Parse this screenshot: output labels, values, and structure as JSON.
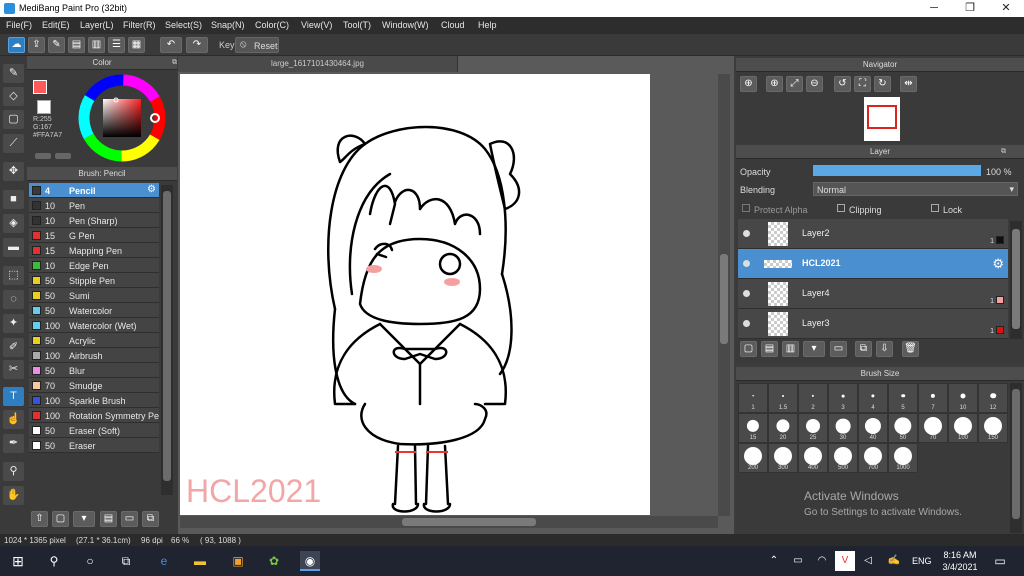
{
  "window": {
    "title": "MediBang Paint Pro (32bit)",
    "minimize": "─",
    "maximize": "❐",
    "close": "✕"
  },
  "menu": [
    "File(F)",
    "Edit(E)",
    "Layer(L)",
    "Filter(R)",
    "Select(S)",
    "Snap(N)",
    "Color(C)",
    "View(V)",
    "Tool(T)",
    "Window(W)",
    "Cloud",
    "Help"
  ],
  "toolbar": {
    "key_label": "Key",
    "reset_label": "Reset"
  },
  "color_panel": {
    "title": "Color",
    "r": "R:255",
    "g": "G:167",
    "hex": "#FFA7A7",
    "primary": "#ff5a5a",
    "secondary": "#ffffff"
  },
  "brush_panel": {
    "title": "Brush: Pencil",
    "brushes": [
      {
        "size": "4",
        "name": "Pencil",
        "color": "#3a3a3a"
      },
      {
        "size": "10",
        "name": "Pen",
        "color": "#333333"
      },
      {
        "size": "10",
        "name": "Pen (Sharp)",
        "color": "#333333"
      },
      {
        "size": "15",
        "name": "G Pen",
        "color": "#e53030"
      },
      {
        "size": "15",
        "name": "Mapping Pen",
        "color": "#e53030"
      },
      {
        "size": "10",
        "name": "Edge Pen",
        "color": "#3dbb3d"
      },
      {
        "size": "50",
        "name": "Stipple Pen",
        "color": "#e8d020"
      },
      {
        "size": "50",
        "name": "Sumi",
        "color": "#e8d020"
      },
      {
        "size": "50",
        "name": "Watercolor",
        "color": "#66ccee"
      },
      {
        "size": "100",
        "name": "Watercolor (Wet)",
        "color": "#66ccee"
      },
      {
        "size": "50",
        "name": "Acrylic",
        "color": "#e8d020"
      },
      {
        "size": "100",
        "name": "Airbrush",
        "color": "#aaaaaa"
      },
      {
        "size": "50",
        "name": "Blur",
        "color": "#f08ae8"
      },
      {
        "size": "70",
        "name": "Smudge",
        "color": "#f5c9a0"
      },
      {
        "size": "100",
        "name": "Sparkle Brush",
        "color": "#3355dd"
      },
      {
        "size": "100",
        "name": "Rotation Symmetry Pe",
        "color": "#e53030"
      },
      {
        "size": "50",
        "name": "Eraser (Soft)",
        "color": "#ffffff"
      },
      {
        "size": "50",
        "name": "Eraser",
        "color": "#ffffff"
      }
    ]
  },
  "document": {
    "tab": "large_1617101430464.jpg",
    "watermark": "HCL2021"
  },
  "navigator": {
    "title": "Navigator"
  },
  "layer_panel": {
    "title": "Layer",
    "opacity_label": "Opacity",
    "opacity_value": "100 %",
    "opacity_fraction": 1.0,
    "blending_label": "Blending",
    "blending_value": "Normal",
    "protect_alpha": "Protect Alpha",
    "clipping": "Clipping",
    "lock": "Lock",
    "layers": [
      {
        "name": "Layer2",
        "color": "#111111",
        "num": "1"
      },
      {
        "name": "HCL2021",
        "color": "",
        "num": ""
      },
      {
        "name": "Layer4",
        "color": "#f4a0a0",
        "num": "1"
      },
      {
        "name": "Layer3",
        "color": "#dd1111",
        "num": "1"
      }
    ]
  },
  "brush_size": {
    "title": "Brush Size",
    "sizes": [
      "1",
      "1.5",
      "2",
      "3",
      "4",
      "5",
      "7",
      "10",
      "12",
      "15",
      "20",
      "25",
      "30",
      "40",
      "50",
      "70",
      "100",
      "150",
      "200",
      "300",
      "400",
      "500",
      "700",
      "1000"
    ]
  },
  "activation": {
    "line1": "Activate Windows",
    "line2": "Go to Settings to activate Windows."
  },
  "status": {
    "size": "1024 * 1365 pixel",
    "cm": "(27.1 * 36.1cm)",
    "dpi": "96 dpi",
    "zoom": "66 %",
    "coords": "( 93, 1088 )"
  },
  "taskbar": {
    "lang": "ENG",
    "time": "8:16 AM",
    "date": "3/4/2021"
  }
}
